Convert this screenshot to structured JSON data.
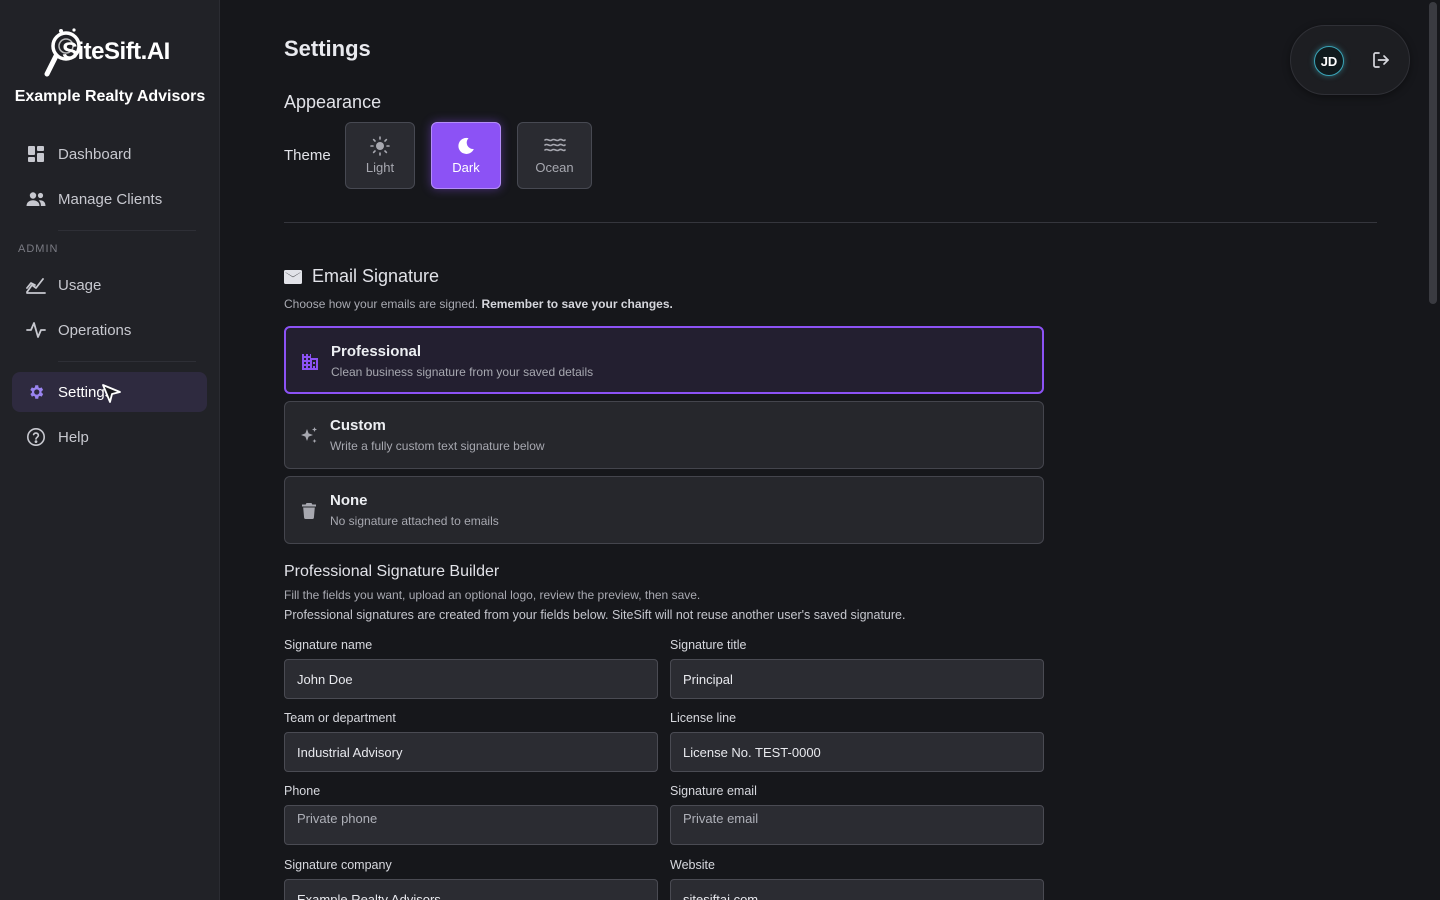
{
  "brand": {
    "logo_text": "SiteSift.AI",
    "org_name": "Example Realty Advisors"
  },
  "sidebar": {
    "items": [
      {
        "label": "Dashboard",
        "icon": "dashboard-icon"
      },
      {
        "label": "Manage Clients",
        "icon": "people-icon"
      }
    ],
    "admin_label": "ADMIN",
    "admin_items": [
      {
        "label": "Usage",
        "icon": "usage-chart-icon"
      },
      {
        "label": "Operations",
        "icon": "activity-icon"
      }
    ],
    "bottom_items": [
      {
        "label": "Settings",
        "icon": "gear-icon",
        "active": true
      },
      {
        "label": "Help",
        "icon": "help-circle-icon"
      }
    ]
  },
  "page": {
    "title": "Settings",
    "appearance": {
      "title": "Appearance",
      "theme_label": "Theme",
      "themes": [
        {
          "label": "Light",
          "icon": "sun-icon"
        },
        {
          "label": "Dark",
          "icon": "moon-icon",
          "selected": true
        },
        {
          "label": "Ocean",
          "icon": "waves-icon"
        }
      ]
    },
    "email_signature": {
      "title": "Email Signature",
      "description": "Choose how your emails are signed.",
      "description_bold": "Remember to save your changes.",
      "options": [
        {
          "title": "Professional",
          "desc": "Clean business signature from your saved details",
          "icon": "building-icon",
          "selected": true
        },
        {
          "title": "Custom",
          "desc": "Write a fully custom text signature below",
          "icon": "sparkles-icon"
        },
        {
          "title": "None",
          "desc": "No signature attached to emails",
          "icon": "trash-icon"
        }
      ]
    },
    "builder": {
      "title": "Professional Signature Builder",
      "desc1": "Fill the fields you want, upload an optional logo, review the preview, then save.",
      "desc2": "Professional signatures are created from your fields below. SiteSift will not reuse another user's saved signature.",
      "fields": {
        "name": {
          "label": "Signature name",
          "value": "John Doe"
        },
        "title": {
          "label": "Signature title",
          "value": "Principal"
        },
        "team": {
          "label": "Team or department",
          "value": "Industrial Advisory"
        },
        "license": {
          "label": "License line",
          "value": "License No. TEST-0000"
        },
        "phone": {
          "label": "Phone",
          "value": "",
          "placeholder": "Private phone"
        },
        "email": {
          "label": "Signature email",
          "value": "",
          "placeholder": "Private email"
        },
        "company": {
          "label": "Signature company",
          "value": "Example Realty Advisors"
        },
        "website": {
          "label": "Website",
          "value": "sitesiftai.com"
        }
      }
    }
  },
  "account": {
    "initials": "JD",
    "logout_icon": "logout-icon"
  },
  "colors": {
    "accent": "#8c52f5",
    "background": "#16171b",
    "sidebar": "#212227",
    "avatar_ring": "#3aa3b6"
  }
}
